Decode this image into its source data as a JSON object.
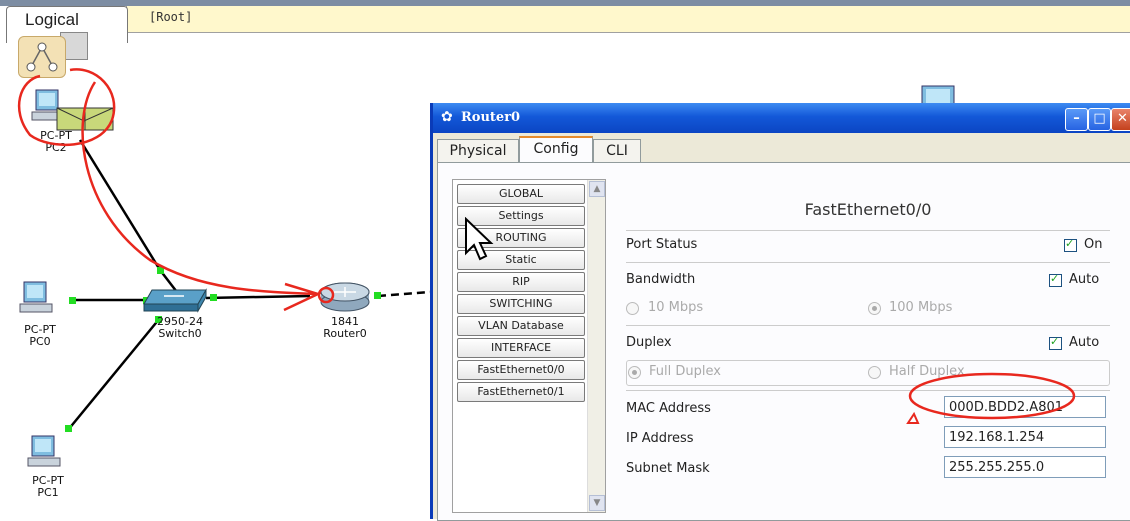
{
  "workspace": {
    "view_label": "Logical",
    "root_label": "[Root]"
  },
  "devices": {
    "pc2": {
      "type": "PC-PT",
      "name": "PC2"
    },
    "pc0": {
      "type": "PC-PT",
      "name": "PC0"
    },
    "pc1": {
      "type": "PC-PT",
      "name": "PC1"
    },
    "switch0": {
      "type": "2950-24",
      "name": "Switch0"
    },
    "router0": {
      "type": "1841",
      "name": "Router0"
    }
  },
  "dialog": {
    "title": "Router0",
    "tabs": [
      {
        "label": "Physical"
      },
      {
        "label": "Config"
      },
      {
        "label": "CLI"
      }
    ],
    "active_tab": "Config",
    "nav_items": [
      "GLOBAL",
      "Settings",
      "ROUTING",
      "Static",
      "RIP",
      "SWITCHING",
      "VLAN Database",
      "INTERFACE",
      "FastEthernet0/0",
      "FastEthernet0/1"
    ],
    "interface": {
      "title": "FastEthernet0/0",
      "port_status_label": "Port Status",
      "port_status_value": "On",
      "bandwidth_label": "Bandwidth",
      "bandwidth_auto": "Auto",
      "bw_option_10": "10 Mbps",
      "bw_option_100": "100 Mbps",
      "duplex_label": "Duplex",
      "duplex_auto": "Auto",
      "duplex_full": "Full Duplex",
      "duplex_half": "Half Duplex",
      "mac_label": "MAC Address",
      "mac_value": "000D.BDD2.A801",
      "ip_label": "IP Address",
      "ip_value": "192.168.1.254",
      "mask_label": "Subnet Mask",
      "mask_value": "255.255.255.0"
    }
  },
  "colors": {
    "title_bar": "#1358d8",
    "link_green": "#22dd22",
    "annotation_red": "#e8281e",
    "root_bar": "#fff8cc"
  }
}
